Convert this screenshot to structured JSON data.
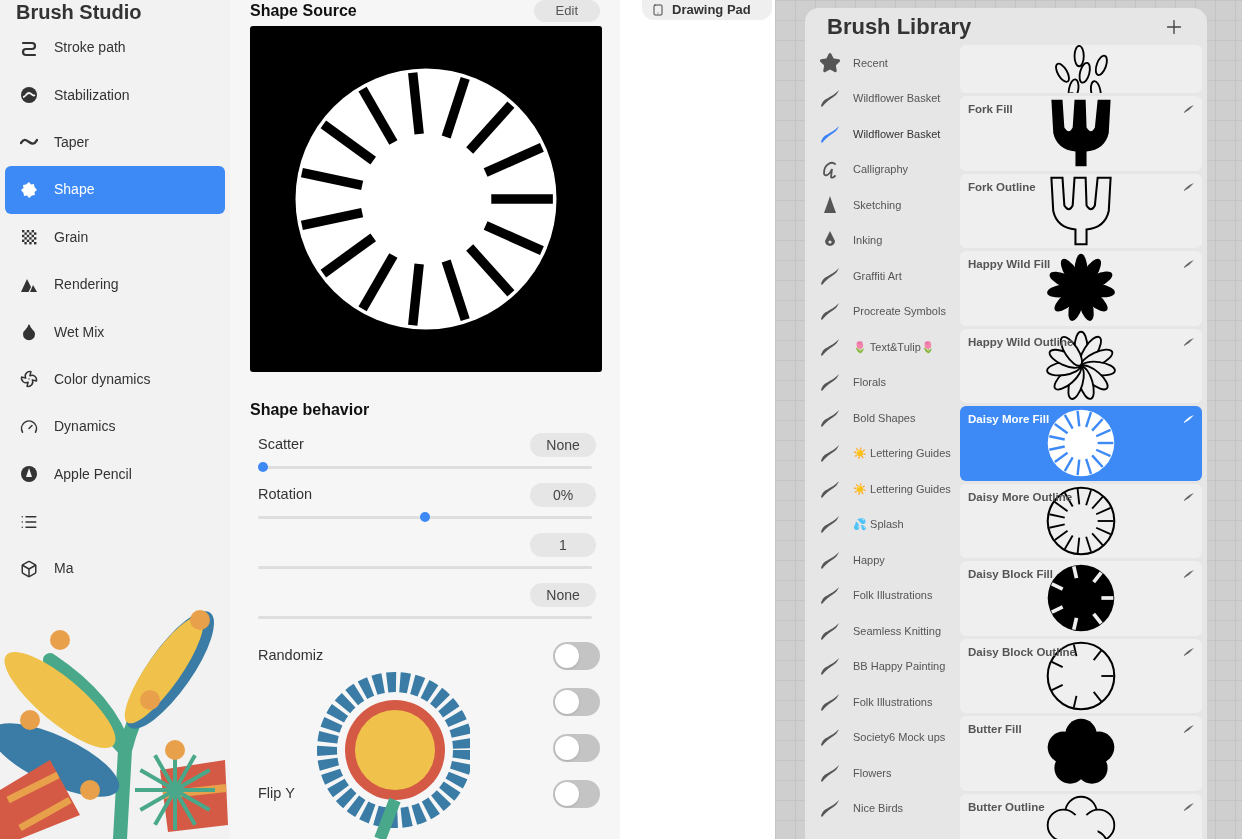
{
  "studio": {
    "title": "Brush Studio",
    "items": [
      {
        "label": "Stroke path",
        "selected": false
      },
      {
        "label": "Stabilization",
        "selected": false
      },
      {
        "label": "Taper",
        "selected": false
      },
      {
        "label": "Shape",
        "selected": true
      },
      {
        "label": "Grain",
        "selected": false
      },
      {
        "label": "Rendering",
        "selected": false
      },
      {
        "label": "Wet Mix",
        "selected": false
      },
      {
        "label": "Color dynamics",
        "selected": false
      },
      {
        "label": "Dynamics",
        "selected": false
      },
      {
        "label": "Apple Pencil",
        "selected": false
      },
      {
        "selected": false
      },
      {
        "label": "Ma",
        "selected": false
      }
    ]
  },
  "shape_panel": {
    "section": "Shape Source",
    "edit": "Edit",
    "behavior_title": "Shape behavior",
    "sliders": [
      {
        "label": "Scatter",
        "value": "None",
        "level": 0
      },
      {
        "label": "Rotation",
        "value": "0%",
        "level": 0.5
      },
      {
        "value": "1"
      },
      {
        "value": "None"
      }
    ],
    "toggles": [
      {
        "label": "Randomiz",
        "on": false
      },
      {
        "on": false
      },
      {
        "on": false
      },
      {
        "label": "Flip Y",
        "on": false
      }
    ]
  },
  "drawing_pad": {
    "label": "Drawing Pad"
  },
  "library": {
    "title": "Brush Library",
    "categories": [
      {
        "name": "Recent",
        "selected": false
      },
      {
        "name": "Wildflower Basket",
        "selected": false
      },
      {
        "name": "Wildflower Basket",
        "selected": true
      },
      {
        "name": "Calligraphy",
        "selected": false
      },
      {
        "name": "Sketching",
        "selected": false
      },
      {
        "name": "Inking",
        "selected": false
      },
      {
        "name": "Graffiti Art",
        "selected": false
      },
      {
        "name": "Procreate Symbols",
        "selected": false
      },
      {
        "name": "🌷 Text&Tulip🌷",
        "selected": false
      },
      {
        "name": "Florals",
        "selected": false
      },
      {
        "name": "Bold Shapes",
        "selected": false
      },
      {
        "name": "☀️ Lettering Guides",
        "selected": false
      },
      {
        "name": "☀️ Lettering Guides",
        "selected": false
      },
      {
        "name": "💦 Splash",
        "selected": false
      },
      {
        "name": "Happy",
        "selected": false
      },
      {
        "name": "Folk Illustrations",
        "selected": false
      },
      {
        "name": "Seamless Knitting",
        "selected": false
      },
      {
        "name": "BB Happy Painting",
        "selected": false
      },
      {
        "name": "Folk Illustrations",
        "selected": false
      },
      {
        "name": "Society6 Mock ups",
        "selected": false
      },
      {
        "name": "Flowers",
        "selected": false
      },
      {
        "name": "Nice Birds",
        "selected": false
      }
    ],
    "brushes": [
      {
        "selected": false
      },
      {
        "name": "Fork Fill",
        "selected": false
      },
      {
        "name": "Fork Outline",
        "selected": false
      },
      {
        "name": "Happy Wild Fill",
        "selected": false
      },
      {
        "name": "Happy Wild Outline",
        "selected": false
      },
      {
        "name": "Daisy More Fill",
        "selected": true
      },
      {
        "name": "Daisy More Outline",
        "selected": false
      },
      {
        "name": "Daisy Block Fill",
        "selected": false
      },
      {
        "name": "Daisy Block Outline",
        "selected": false
      },
      {
        "name": "Butter Fill",
        "selected": false
      },
      {
        "name": "Butter Outline",
        "selected": false
      }
    ]
  }
}
